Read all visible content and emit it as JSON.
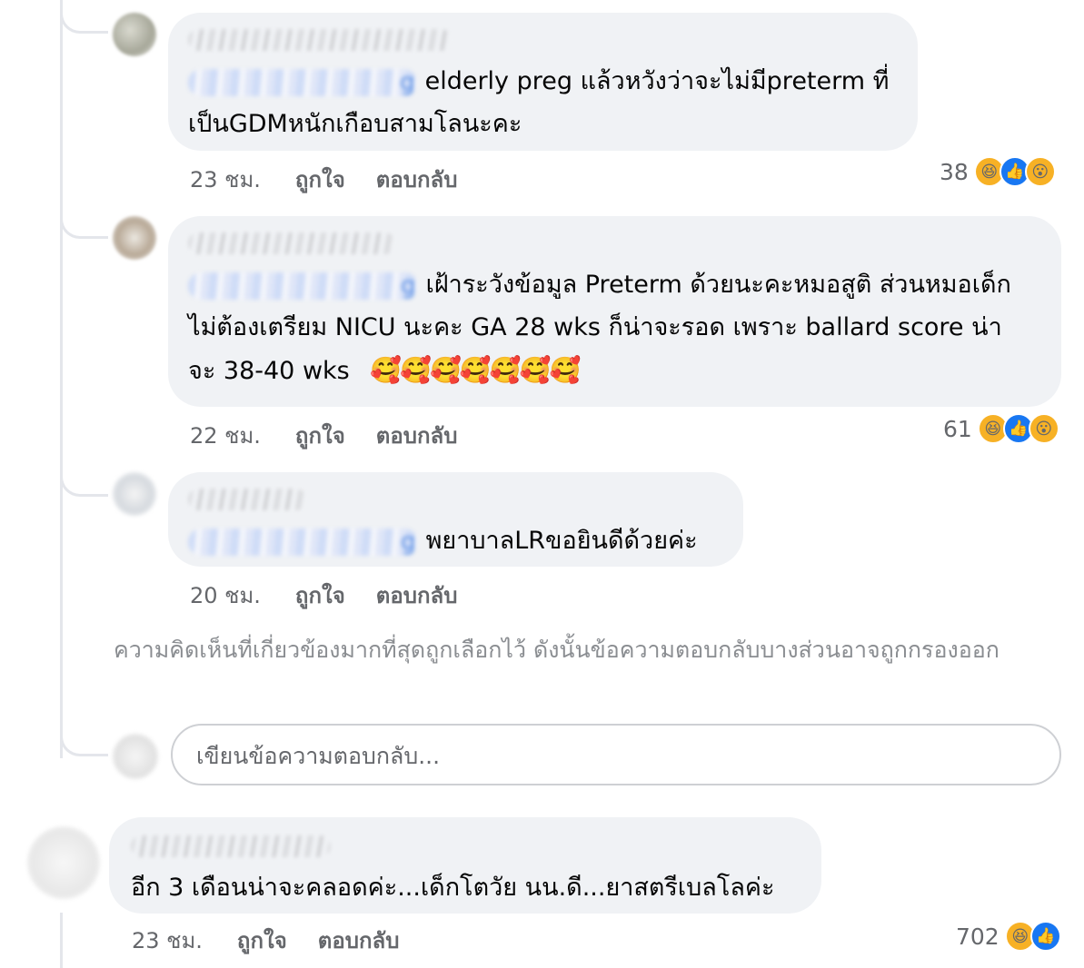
{
  "comments": [
    {
      "mention_tail": "g",
      "text_line1": "elderly preg แล้วหวังว่าจะไม่มีpreterm ที่",
      "text_line2": "เป็นGDMหนักเกือบสามโลนะคะ",
      "time": "23 ชม.",
      "like_label": "ถูกใจ",
      "reply_label": "ตอบกลับ",
      "reaction_count": "38"
    },
    {
      "mention_tail": "g",
      "text_line1": "เฝ้าระวังข้อมูล Preterm ด้วยนะคะหมอสูติ ส่วนหมอเด็ก",
      "text_line2": "ไม่ต้องเตรียม NICU นะคะ GA 28 wks  ก็น่าจะรอด เพราะ ballard score น่า",
      "text_line3": "จะ 38-40 wks",
      "emoji_row": "🥰🥰🥰🥰🥰🥰🥰",
      "time": "22 ชม.",
      "like_label": "ถูกใจ",
      "reply_label": "ตอบกลับ",
      "reaction_count": "61"
    },
    {
      "mention_tail": "g",
      "text_line1": "พยาบาลLRขอยินดีด้วยค่ะ",
      "time": "20 ชม.",
      "like_label": "ถูกใจ",
      "reply_label": "ตอบกลับ"
    }
  ],
  "notice": "ความคิดเห็นที่เกี่ยวข้องมากที่สุดถูกเลือกไว้ ดังนั้นข้อความตอบกลับบางส่วนอาจถูกกรองออก",
  "reply_placeholder": "เขียนข้อความตอบกลับ...",
  "top_comment": {
    "text": "อีก 3 เดือนน่าจะคลอดค่ะ...เด็กโตวัย นน.ดี...ยาสตรีเบลโลค่ะ",
    "time": "23 ชม.",
    "like_label": "ถูกใจ",
    "reply_label": "ตอบกลับ",
    "reaction_count": "702"
  },
  "reactions": {
    "haha": "😆",
    "like": "👍",
    "wow": "😮"
  },
  "colors": {
    "bubble": "#f0f2f5",
    "meta": "#65676b",
    "like_blue": "#1877f2",
    "haha_yellow": "#f7b125"
  }
}
